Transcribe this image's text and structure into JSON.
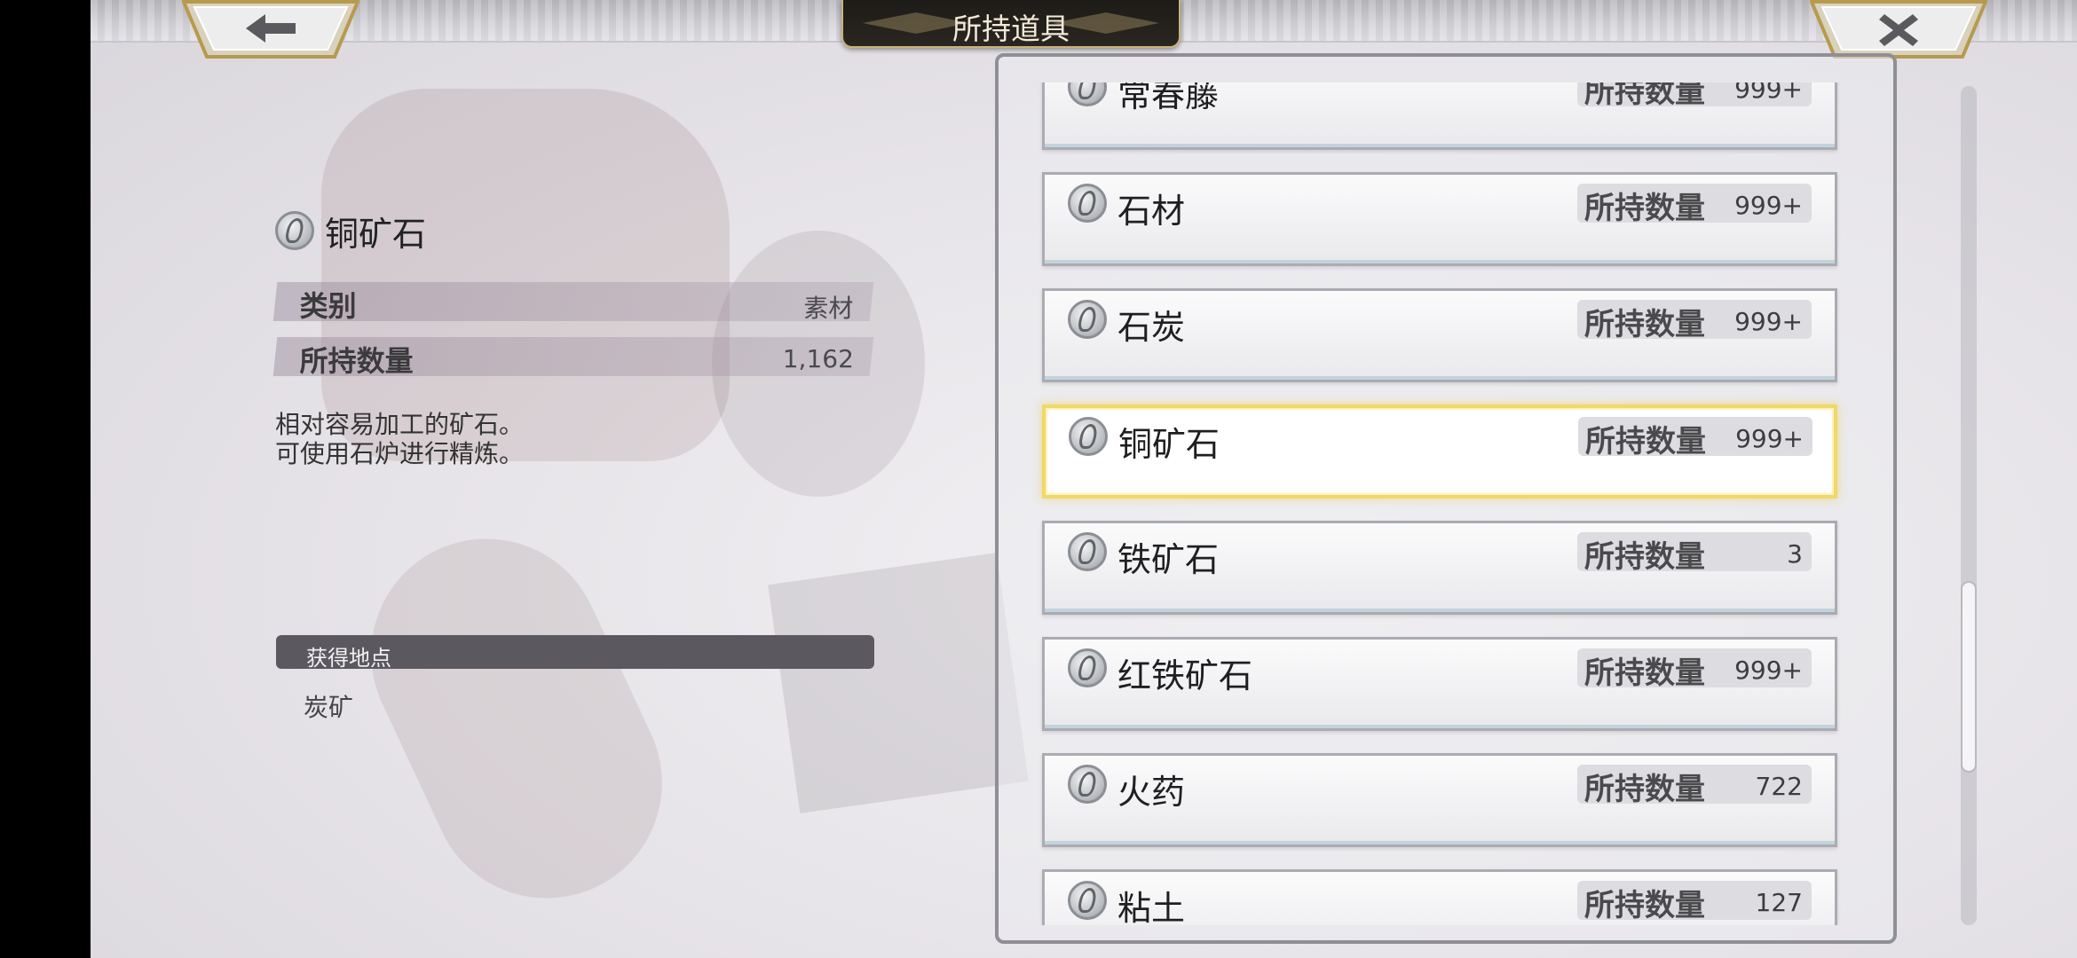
{
  "header": {
    "title": "所持道具",
    "back_icon": "arrow-left-icon",
    "close_icon": "close-x-icon"
  },
  "detail": {
    "icon": "ore-medal-icon",
    "name": "铜矿石",
    "category_label": "类别",
    "category_value": "素材",
    "owned_label": "所持数量",
    "owned_value": "1,162",
    "description": "相对容易加工的矿石。\n可使用石炉进行精炼。",
    "source_header": "获得地点",
    "source": "炭矿"
  },
  "items": [
    {
      "name": "常春藤",
      "qty_label": "所持数量",
      "qty": "999+",
      "selected": false
    },
    {
      "name": "石材",
      "qty_label": "所持数量",
      "qty": "999+",
      "selected": false
    },
    {
      "name": "石炭",
      "qty_label": "所持数量",
      "qty": "999+",
      "selected": false
    },
    {
      "name": "铜矿石",
      "qty_label": "所持数量",
      "qty": "999+",
      "selected": true
    },
    {
      "name": "铁矿石",
      "qty_label": "所持数量",
      "qty": "3",
      "selected": false
    },
    {
      "name": "红铁矿石",
      "qty_label": "所持数量",
      "qty": "999+",
      "selected": false
    },
    {
      "name": "火药",
      "qty_label": "所持数量",
      "qty": "722",
      "selected": false
    },
    {
      "name": "粘土",
      "qty_label": "所持数量",
      "qty": "127",
      "selected": false
    }
  ],
  "colors": {
    "accent_gold": "#c9b37a",
    "selected_border": "#f0d86a",
    "panel_border": "#8f8f96"
  }
}
